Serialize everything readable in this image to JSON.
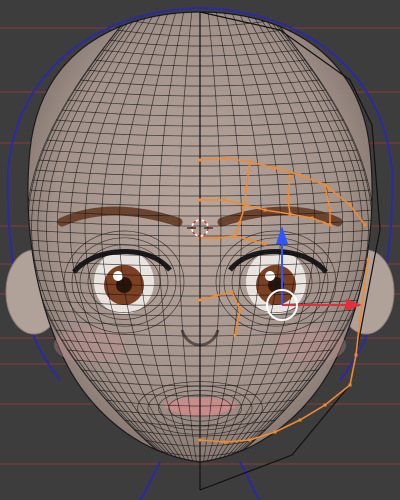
{
  "viewport": {
    "background_color": "#3d3d3d",
    "selected_edge_color": "#f28a2e",
    "wire_color": "#111111",
    "ortho_guide_color": "#a33a3a",
    "reference_stroke_color": "#2a2aa8",
    "skin_color": "#b4a39a",
    "iris_color": "#7b3f22",
    "brow_color": "#6b4430",
    "lip_color": "#cf8b8b",
    "x_axis_color": "#e0303a",
    "y_axis_color": "#2f55ff",
    "cursor_color": "#ffffff",
    "cursor_dash_color": "#c23b3b"
  },
  "icons": {
    "transform_widget": "move-gizmo-icon",
    "3d_cursor": "3d-cursor-icon",
    "pivot": "pivot-circle-icon"
  }
}
